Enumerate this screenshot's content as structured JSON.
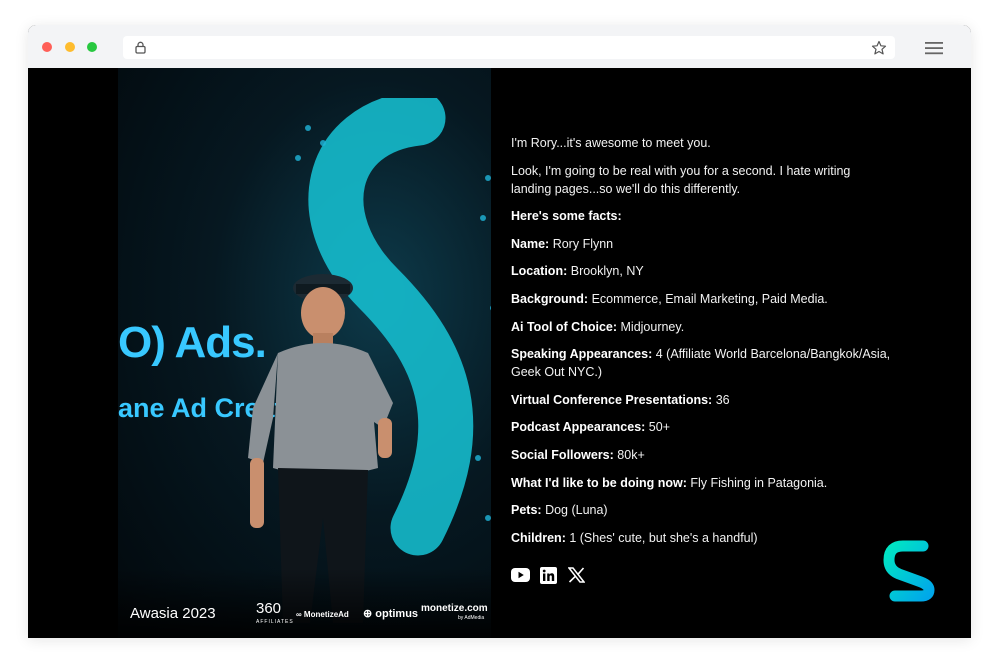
{
  "intro": "I'm Rory...it's awesome to meet you.",
  "lead": "Look, I'm going to be real with you for a second. I hate writing landing pages...so we'll do this differently.",
  "facts_heading": "Here's some facts:",
  "facts": [
    {
      "label": "Name:",
      "value": "Rory Flynn"
    },
    {
      "label": "Location:",
      "value": "Brooklyn, NY"
    },
    {
      "label": "Background:",
      "value": "Ecommerce, Email Marketing, Paid Media."
    },
    {
      "label": "Ai Tool of Choice:",
      "value": "Midjourney."
    },
    {
      "label": "Speaking Appearances:",
      "value": "4 (Affiliate World Barcelona/Bangkok/Asia, Geek Out NYC.)"
    },
    {
      "label": "Virtual Conference Presentations:",
      "value": "36"
    },
    {
      "label": "Podcast Appearances:",
      "value": "50+"
    },
    {
      "label": "Social Followers:",
      "value": "80k+"
    },
    {
      "label": "What I'd like to be doing now:",
      "value": "Fly Fishing in Patagonia."
    },
    {
      "label": "Pets:",
      "value": "Dog (Luna)"
    },
    {
      "label": "Children:",
      "value": "1 (Shes' cute, but she's a handful)"
    }
  ],
  "photo": {
    "screen_text_1": "O) Ads.",
    "screen_text_2": "ane Ad Creati",
    "sponsor_logos": {
      "awasia": "Awasia 2023",
      "affiliates_360": "360",
      "affiliates_360_sub": "AFFILIATES",
      "monetizead": "∞ MonetizeAd",
      "optimus": "⊕ optimus",
      "optimus_sub": "",
      "monetize_com": "monetize.com",
      "monetize_com_sub": "by AdMedia"
    }
  },
  "icons": [
    "youtube-icon",
    "linkedin-icon",
    "x-icon"
  ],
  "colors": {
    "background": "#000000",
    "text": "#f2f2f2",
    "brand_gradient_start": "#00e0c6",
    "brand_gradient_end": "#00a8e8",
    "browser_chrome": "#f3f4f6"
  }
}
